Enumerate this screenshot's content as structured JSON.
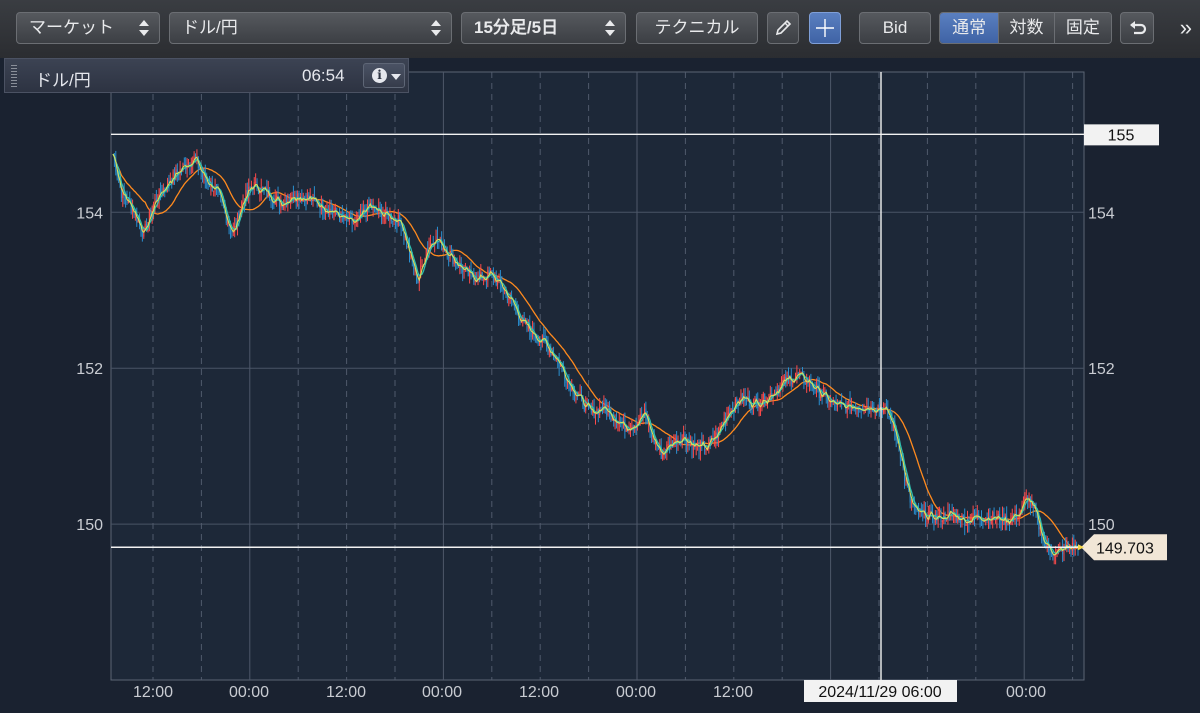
{
  "toolbar": {
    "market_select": "マーケット",
    "pair_select": "ドル/円",
    "period_select": "15分足/5日",
    "technical_button": "テクニカル",
    "pencil_icon": "pencil-icon",
    "crosshair_icon": "crosshair-icon",
    "bid_button": "Bid",
    "scale_modes": [
      "通常",
      "対数",
      "固定"
    ],
    "scale_active": "通常",
    "undo_icon": "undo-icon",
    "more_icon": "double-chevron-right-icon"
  },
  "info_panel": {
    "symbol": "ドル/円",
    "time": "06:54",
    "info_icon": "info-icon"
  },
  "chart_data": {
    "type": "candlestick",
    "instrument": "ドル/円",
    "y_axis": {
      "ticks": [
        150,
        152,
        154
      ],
      "ylim": [
        148.0,
        155.8
      ],
      "side": "both"
    },
    "x_axis": {
      "tick_labels": [
        "12:00",
        "00:00",
        "12:00",
        "00:00",
        "12:00",
        "00:00",
        "12:00",
        "00:00"
      ]
    },
    "grid": true,
    "price_path": [
      [
        0,
        154.75
      ],
      [
        6,
        154.25
      ],
      [
        14,
        154.05
      ],
      [
        22,
        153.72
      ],
      [
        30,
        154.15
      ],
      [
        40,
        154.4
      ],
      [
        50,
        154.58
      ],
      [
        58,
        154.7
      ],
      [
        66,
        154.42
      ],
      [
        74,
        154.28
      ],
      [
        80,
        153.98
      ],
      [
        86,
        153.72
      ],
      [
        92,
        154.12
      ],
      [
        100,
        154.35
      ],
      [
        110,
        154.25
      ],
      [
        120,
        154.12
      ],
      [
        130,
        154.22
      ],
      [
        140,
        154.18
      ],
      [
        150,
        154.08
      ],
      [
        158,
        154.0
      ],
      [
        166,
        153.9
      ],
      [
        174,
        153.85
      ],
      [
        182,
        154.08
      ],
      [
        190,
        154.0
      ],
      [
        198,
        153.95
      ],
      [
        206,
        153.88
      ],
      [
        212,
        153.45
      ],
      [
        218,
        153.12
      ],
      [
        224,
        153.52
      ],
      [
        230,
        153.68
      ],
      [
        238,
        153.52
      ],
      [
        246,
        153.35
      ],
      [
        254,
        153.2
      ],
      [
        262,
        153.15
      ],
      [
        270,
        153.2
      ],
      [
        278,
        153.05
      ],
      [
        286,
        152.82
      ],
      [
        294,
        152.55
      ],
      [
        302,
        152.42
      ],
      [
        310,
        152.3
      ],
      [
        318,
        152.1
      ],
      [
        326,
        151.82
      ],
      [
        334,
        151.6
      ],
      [
        342,
        151.42
      ],
      [
        350,
        151.5
      ],
      [
        358,
        151.38
      ],
      [
        366,
        151.25
      ],
      [
        374,
        151.3
      ],
      [
        380,
        151.42
      ],
      [
        386,
        151.1
      ],
      [
        392,
        150.9
      ],
      [
        400,
        151.05
      ],
      [
        408,
        151.12
      ],
      [
        416,
        151.0
      ],
      [
        424,
        150.98
      ],
      [
        432,
        151.15
      ],
      [
        440,
        151.45
      ],
      [
        450,
        151.62
      ],
      [
        458,
        151.55
      ],
      [
        466,
        151.6
      ],
      [
        474,
        151.72
      ],
      [
        482,
        151.85
      ],
      [
        490,
        151.9
      ],
      [
        498,
        151.82
      ],
      [
        506,
        151.68
      ],
      [
        514,
        151.55
      ],
      [
        522,
        151.5
      ],
      [
        532,
        151.52
      ],
      [
        542,
        151.5
      ],
      [
        550,
        151.5
      ],
      [
        556,
        151.35
      ],
      [
        562,
        151.0
      ],
      [
        566,
        150.6
      ],
      [
        570,
        150.3
      ],
      [
        574,
        150.15
      ],
      [
        582,
        150.1
      ],
      [
        590,
        150.08
      ],
      [
        600,
        150.12
      ],
      [
        610,
        150.05
      ],
      [
        620,
        150.1
      ],
      [
        630,
        150.08
      ],
      [
        640,
        150.05
      ],
      [
        648,
        150.15
      ],
      [
        654,
        150.35
      ],
      [
        660,
        150.1
      ],
      [
        666,
        149.75
      ],
      [
        674,
        149.62
      ],
      [
        682,
        149.7
      ],
      [
        690,
        149.703
      ]
    ],
    "series": [
      {
        "name": "",
        "role": "short-ma",
        "color": "#d8e05a"
      },
      {
        "name": "",
        "role": "mid-ma",
        "color": "#2fc0b0"
      },
      {
        "name": "",
        "role": "long-ma",
        "color": "#ff8a1e"
      }
    ],
    "candle_colors": {
      "up": "#ff4a4a",
      "down": "#2a8fd0"
    },
    "horizontal_lines": [
      {
        "value": 155,
        "label": "155"
      },
      {
        "value": 149.703,
        "label": "149.703"
      }
    ],
    "crosshair": {
      "label": "2024/11/29 06:00"
    }
  }
}
